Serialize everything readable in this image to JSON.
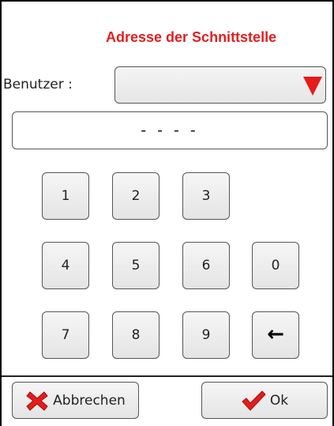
{
  "dialog": {
    "title": "Adresse der Schnittstelle"
  },
  "user": {
    "label": "Benutzer :",
    "selected_value": ""
  },
  "code": {
    "value": "- - - -"
  },
  "keypad": {
    "keys": [
      "1",
      "2",
      "3",
      "4",
      "5",
      "6",
      "0",
      "7",
      "8",
      "9"
    ],
    "backspace_icon": "left-arrow-icon"
  },
  "buttons": {
    "cancel_label": "Abbrechen",
    "cancel_icon": "red-x-icon",
    "ok_label": "Ok",
    "ok_icon": "red-checkmark-icon"
  },
  "colors": {
    "accent": "#e02020",
    "dropdown_arrow": "#e61b1b"
  }
}
